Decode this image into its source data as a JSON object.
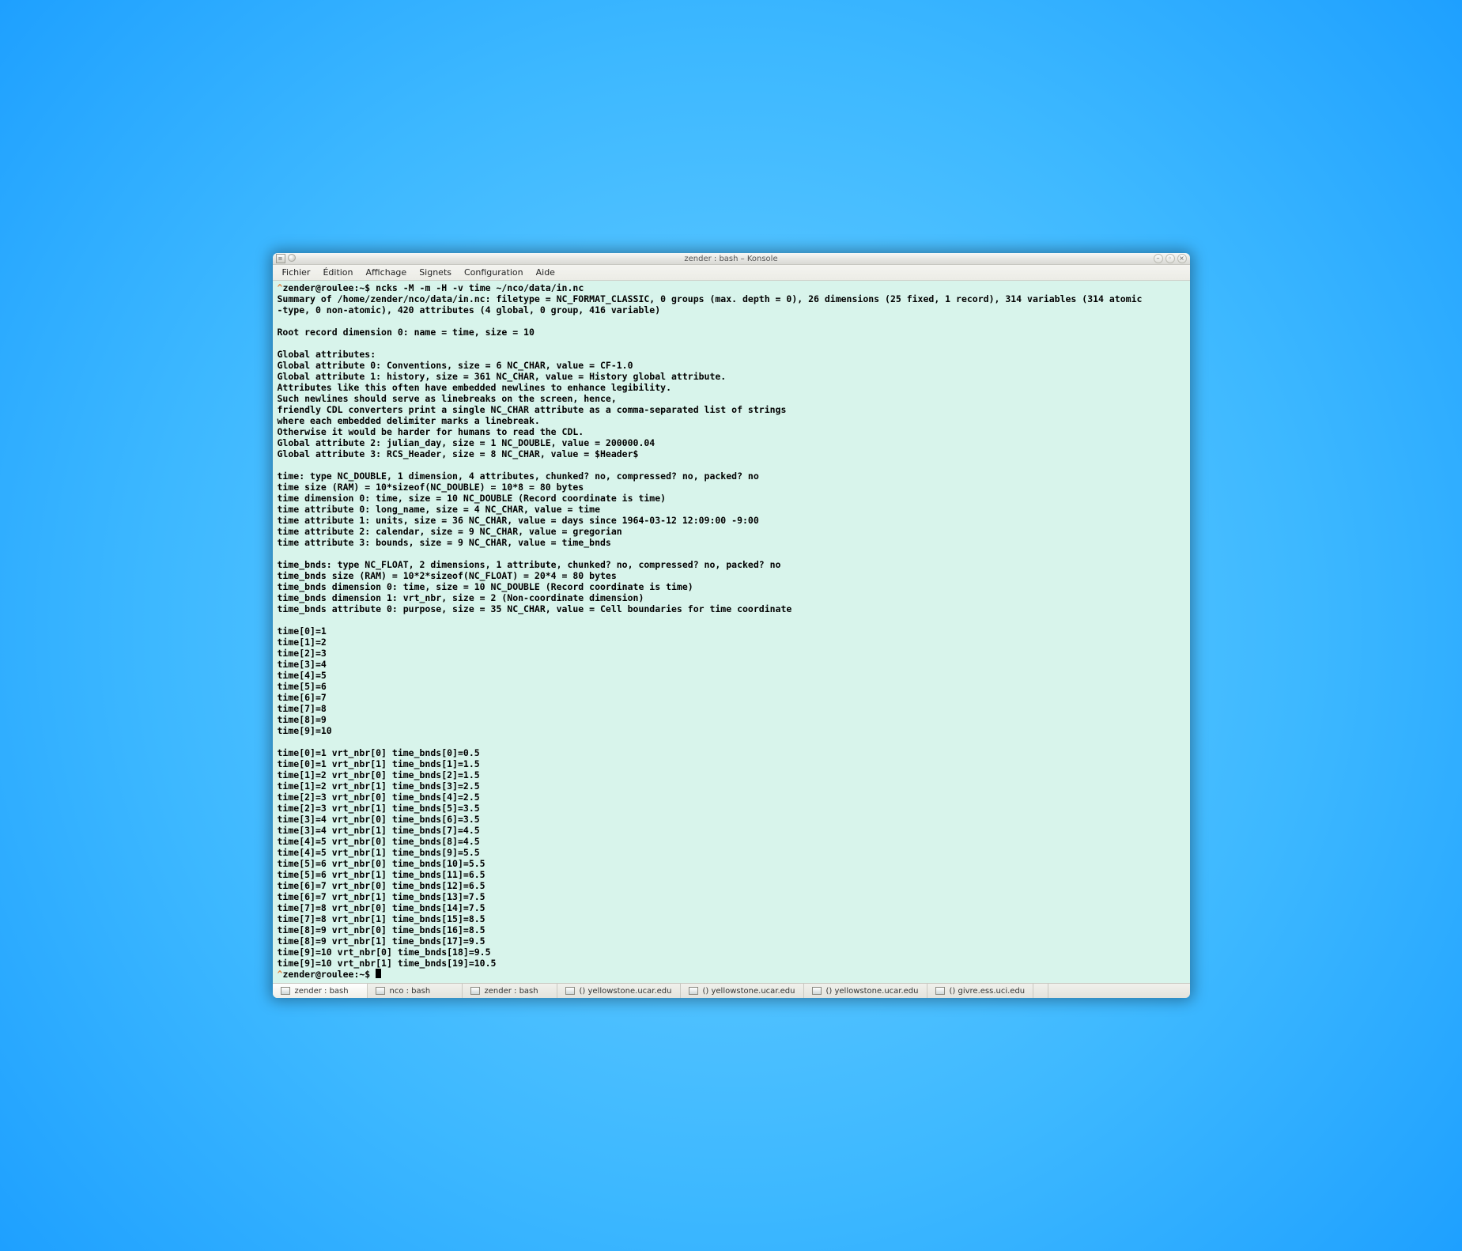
{
  "window": {
    "title": "zender : bash – Konsole"
  },
  "menu": {
    "items": [
      "Fichier",
      "Édition",
      "Affichage",
      "Signets",
      "Configuration",
      "Aide"
    ]
  },
  "terminal": {
    "prompt1_user": "zender@roulee:~$ ",
    "command": "ncks -M -m -H -v time ~/nco/data/in.nc",
    "body": "Summary of /home/zender/nco/data/in.nc: filetype = NC_FORMAT_CLASSIC, 0 groups (max. depth = 0), 26 dimensions (25 fixed, 1 record), 314 variables (314 atomic\n-type, 0 non-atomic), 420 attributes (4 global, 0 group, 416 variable)\n\nRoot record dimension 0: name = time, size = 10\n\nGlobal attributes:\nGlobal attribute 0: Conventions, size = 6 NC_CHAR, value = CF-1.0\nGlobal attribute 1: history, size = 361 NC_CHAR, value = History global attribute.\nAttributes like this often have embedded newlines to enhance legibility.\nSuch newlines should serve as linebreaks on the screen, hence,\nfriendly CDL converters print a single NC_CHAR attribute as a comma-separated list of strings\nwhere each embedded delimiter marks a linebreak.\nOtherwise it would be harder for humans to read the CDL.\nGlobal attribute 2: julian_day, size = 1 NC_DOUBLE, value = 200000.04\nGlobal attribute 3: RCS_Header, size = 8 NC_CHAR, value = $Header$\n\ntime: type NC_DOUBLE, 1 dimension, 4 attributes, chunked? no, compressed? no, packed? no\ntime size (RAM) = 10*sizeof(NC_DOUBLE) = 10*8 = 80 bytes\ntime dimension 0: time, size = 10 NC_DOUBLE (Record coordinate is time)\ntime attribute 0: long_name, size = 4 NC_CHAR, value = time\ntime attribute 1: units, size = 36 NC_CHAR, value = days since 1964-03-12 12:09:00 -9:00\ntime attribute 2: calendar, size = 9 NC_CHAR, value = gregorian\ntime attribute 3: bounds, size = 9 NC_CHAR, value = time_bnds\n\ntime_bnds: type NC_FLOAT, 2 dimensions, 1 attribute, chunked? no, compressed? no, packed? no\ntime_bnds size (RAM) = 10*2*sizeof(NC_FLOAT) = 20*4 = 80 bytes\ntime_bnds dimension 0: time, size = 10 NC_DOUBLE (Record coordinate is time)\ntime_bnds dimension 1: vrt_nbr, size = 2 (Non-coordinate dimension)\ntime_bnds attribute 0: purpose, size = 35 NC_CHAR, value = Cell boundaries for time coordinate\n\ntime[0]=1\ntime[1]=2\ntime[2]=3\ntime[3]=4\ntime[4]=5\ntime[5]=6\ntime[6]=7\ntime[7]=8\ntime[8]=9\ntime[9]=10\n\ntime[0]=1 vrt_nbr[0] time_bnds[0]=0.5\ntime[0]=1 vrt_nbr[1] time_bnds[1]=1.5\ntime[1]=2 vrt_nbr[0] time_bnds[2]=1.5\ntime[1]=2 vrt_nbr[1] time_bnds[3]=2.5\ntime[2]=3 vrt_nbr[0] time_bnds[4]=2.5\ntime[2]=3 vrt_nbr[1] time_bnds[5]=3.5\ntime[3]=4 vrt_nbr[0] time_bnds[6]=3.5\ntime[3]=4 vrt_nbr[1] time_bnds[7]=4.5\ntime[4]=5 vrt_nbr[0] time_bnds[8]=4.5\ntime[4]=5 vrt_nbr[1] time_bnds[9]=5.5\ntime[5]=6 vrt_nbr[0] time_bnds[10]=5.5\ntime[5]=6 vrt_nbr[1] time_bnds[11]=6.5\ntime[6]=7 vrt_nbr[0] time_bnds[12]=6.5\ntime[6]=7 vrt_nbr[1] time_bnds[13]=7.5\ntime[7]=8 vrt_nbr[0] time_bnds[14]=7.5\ntime[7]=8 vrt_nbr[1] time_bnds[15]=8.5\ntime[8]=9 vrt_nbr[0] time_bnds[16]=8.5\ntime[8]=9 vrt_nbr[1] time_bnds[17]=9.5\ntime[9]=10 vrt_nbr[0] time_bnds[18]=9.5\ntime[9]=10 vrt_nbr[1] time_bnds[19]=10.5",
    "prompt2_user": "zender@roulee:~$ "
  },
  "tabs": {
    "items": [
      {
        "label": "zender : bash"
      },
      {
        "label": "nco : bash"
      },
      {
        "label": "zender : bash"
      },
      {
        "label": "() yellowstone.ucar.edu"
      },
      {
        "label": "() yellowstone.ucar.edu"
      },
      {
        "label": "() yellowstone.ucar.edu"
      },
      {
        "label": "() givre.ess.uci.edu"
      }
    ]
  }
}
